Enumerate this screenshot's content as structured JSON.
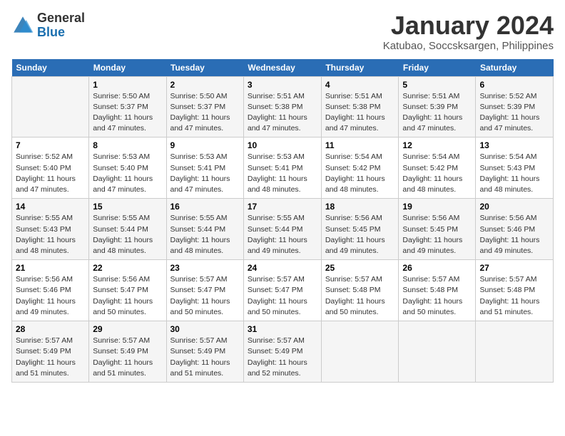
{
  "header": {
    "logo_general": "General",
    "logo_blue": "Blue",
    "main_title": "January 2024",
    "subtitle": "Katubao, Soccsksargen, Philippines"
  },
  "weekdays": [
    "Sunday",
    "Monday",
    "Tuesday",
    "Wednesday",
    "Thursday",
    "Friday",
    "Saturday"
  ],
  "weeks": [
    [
      {
        "day": "",
        "info": ""
      },
      {
        "day": "1",
        "info": "Sunrise: 5:50 AM\nSunset: 5:37 PM\nDaylight: 11 hours\nand 47 minutes."
      },
      {
        "day": "2",
        "info": "Sunrise: 5:50 AM\nSunset: 5:37 PM\nDaylight: 11 hours\nand 47 minutes."
      },
      {
        "day": "3",
        "info": "Sunrise: 5:51 AM\nSunset: 5:38 PM\nDaylight: 11 hours\nand 47 minutes."
      },
      {
        "day": "4",
        "info": "Sunrise: 5:51 AM\nSunset: 5:38 PM\nDaylight: 11 hours\nand 47 minutes."
      },
      {
        "day": "5",
        "info": "Sunrise: 5:51 AM\nSunset: 5:39 PM\nDaylight: 11 hours\nand 47 minutes."
      },
      {
        "day": "6",
        "info": "Sunrise: 5:52 AM\nSunset: 5:39 PM\nDaylight: 11 hours\nand 47 minutes."
      }
    ],
    [
      {
        "day": "7",
        "info": "Sunrise: 5:52 AM\nSunset: 5:40 PM\nDaylight: 11 hours\nand 47 minutes."
      },
      {
        "day": "8",
        "info": "Sunrise: 5:53 AM\nSunset: 5:40 PM\nDaylight: 11 hours\nand 47 minutes."
      },
      {
        "day": "9",
        "info": "Sunrise: 5:53 AM\nSunset: 5:41 PM\nDaylight: 11 hours\nand 47 minutes."
      },
      {
        "day": "10",
        "info": "Sunrise: 5:53 AM\nSunset: 5:41 PM\nDaylight: 11 hours\nand 48 minutes."
      },
      {
        "day": "11",
        "info": "Sunrise: 5:54 AM\nSunset: 5:42 PM\nDaylight: 11 hours\nand 48 minutes."
      },
      {
        "day": "12",
        "info": "Sunrise: 5:54 AM\nSunset: 5:42 PM\nDaylight: 11 hours\nand 48 minutes."
      },
      {
        "day": "13",
        "info": "Sunrise: 5:54 AM\nSunset: 5:43 PM\nDaylight: 11 hours\nand 48 minutes."
      }
    ],
    [
      {
        "day": "14",
        "info": "Sunrise: 5:55 AM\nSunset: 5:43 PM\nDaylight: 11 hours\nand 48 minutes."
      },
      {
        "day": "15",
        "info": "Sunrise: 5:55 AM\nSunset: 5:44 PM\nDaylight: 11 hours\nand 48 minutes."
      },
      {
        "day": "16",
        "info": "Sunrise: 5:55 AM\nSunset: 5:44 PM\nDaylight: 11 hours\nand 48 minutes."
      },
      {
        "day": "17",
        "info": "Sunrise: 5:55 AM\nSunset: 5:44 PM\nDaylight: 11 hours\nand 49 minutes."
      },
      {
        "day": "18",
        "info": "Sunrise: 5:56 AM\nSunset: 5:45 PM\nDaylight: 11 hours\nand 49 minutes."
      },
      {
        "day": "19",
        "info": "Sunrise: 5:56 AM\nSunset: 5:45 PM\nDaylight: 11 hours\nand 49 minutes."
      },
      {
        "day": "20",
        "info": "Sunrise: 5:56 AM\nSunset: 5:46 PM\nDaylight: 11 hours\nand 49 minutes."
      }
    ],
    [
      {
        "day": "21",
        "info": "Sunrise: 5:56 AM\nSunset: 5:46 PM\nDaylight: 11 hours\nand 49 minutes."
      },
      {
        "day": "22",
        "info": "Sunrise: 5:56 AM\nSunset: 5:47 PM\nDaylight: 11 hours\nand 50 minutes."
      },
      {
        "day": "23",
        "info": "Sunrise: 5:57 AM\nSunset: 5:47 PM\nDaylight: 11 hours\nand 50 minutes."
      },
      {
        "day": "24",
        "info": "Sunrise: 5:57 AM\nSunset: 5:47 PM\nDaylight: 11 hours\nand 50 minutes."
      },
      {
        "day": "25",
        "info": "Sunrise: 5:57 AM\nSunset: 5:48 PM\nDaylight: 11 hours\nand 50 minutes."
      },
      {
        "day": "26",
        "info": "Sunrise: 5:57 AM\nSunset: 5:48 PM\nDaylight: 11 hours\nand 50 minutes."
      },
      {
        "day": "27",
        "info": "Sunrise: 5:57 AM\nSunset: 5:48 PM\nDaylight: 11 hours\nand 51 minutes."
      }
    ],
    [
      {
        "day": "28",
        "info": "Sunrise: 5:57 AM\nSunset: 5:49 PM\nDaylight: 11 hours\nand 51 minutes."
      },
      {
        "day": "29",
        "info": "Sunrise: 5:57 AM\nSunset: 5:49 PM\nDaylight: 11 hours\nand 51 minutes."
      },
      {
        "day": "30",
        "info": "Sunrise: 5:57 AM\nSunset: 5:49 PM\nDaylight: 11 hours\nand 51 minutes."
      },
      {
        "day": "31",
        "info": "Sunrise: 5:57 AM\nSunset: 5:49 PM\nDaylight: 11 hours\nand 52 minutes."
      },
      {
        "day": "",
        "info": ""
      },
      {
        "day": "",
        "info": ""
      },
      {
        "day": "",
        "info": ""
      }
    ]
  ]
}
